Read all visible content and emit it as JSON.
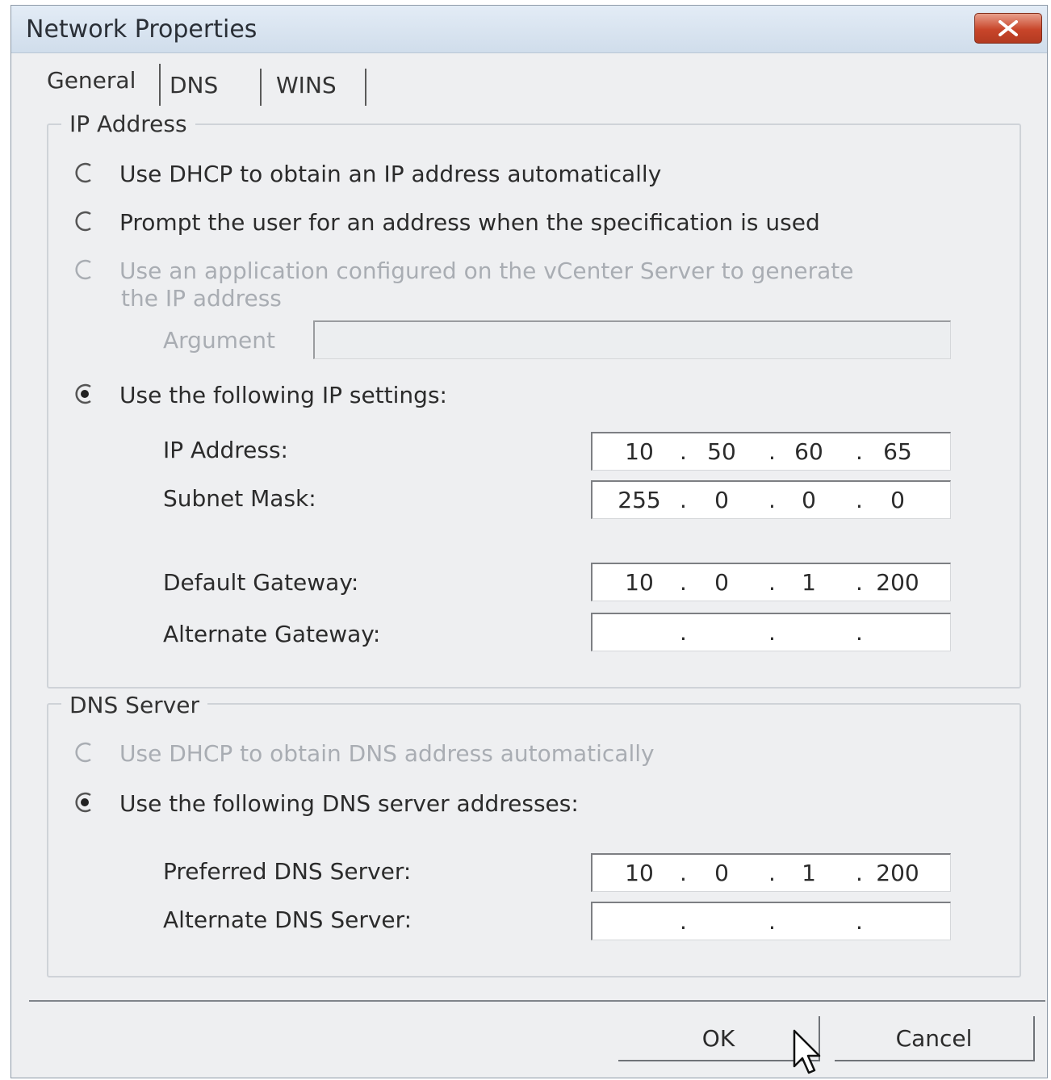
{
  "window": {
    "title": "Network Properties"
  },
  "tabs": [
    {
      "label": "General",
      "active": true
    },
    {
      "label": "DNS",
      "active": false
    },
    {
      "label": "WINS",
      "active": false
    }
  ],
  "ip_group": {
    "label": "IP Address",
    "options": [
      {
        "label": "Use DHCP to obtain an IP address automatically",
        "selected": false,
        "enabled": true
      },
      {
        "label": "Prompt the user for an address when the specification is used",
        "selected": false,
        "enabled": true
      },
      {
        "label_line1": "Use an application configured on the vCenter Server to generate",
        "label_line2": "the IP address",
        "selected": false,
        "enabled": false
      },
      {
        "label": "Use the following IP settings:",
        "selected": true,
        "enabled": true
      }
    ],
    "argument": {
      "label": "Argument",
      "value": ""
    },
    "fields": {
      "ip_address": {
        "label": "IP Address:",
        "octets": [
          "10",
          "50",
          "60",
          "65"
        ]
      },
      "subnet_mask": {
        "label": "Subnet Mask:",
        "octets": [
          "255",
          "0",
          "0",
          "0"
        ]
      },
      "default_gateway": {
        "label": "Default Gateway:",
        "octets": [
          "10",
          "0",
          "1",
          "200"
        ]
      },
      "alternate_gateway": {
        "label": "Alternate Gateway:",
        "octets": [
          "",
          "",
          "",
          ""
        ]
      }
    }
  },
  "dns_group": {
    "label": "DNS Server",
    "options": [
      {
        "label": "Use DHCP to obtain DNS address automatically",
        "selected": false,
        "enabled": false
      },
      {
        "label": "Use the following DNS server addresses:",
        "selected": true,
        "enabled": true
      }
    ],
    "fields": {
      "preferred": {
        "label": "Preferred DNS Server:",
        "octets": [
          "10",
          "0",
          "1",
          "200"
        ]
      },
      "alternate": {
        "label": "Alternate DNS Server:",
        "octets": [
          "",
          "",
          "",
          ""
        ]
      }
    }
  },
  "buttons": {
    "ok": "OK",
    "cancel": "Cancel"
  },
  "colors": {
    "accent_close": "#c8452a",
    "window_bg": "#eeeff1",
    "disabled_text": "#a9adb3"
  }
}
